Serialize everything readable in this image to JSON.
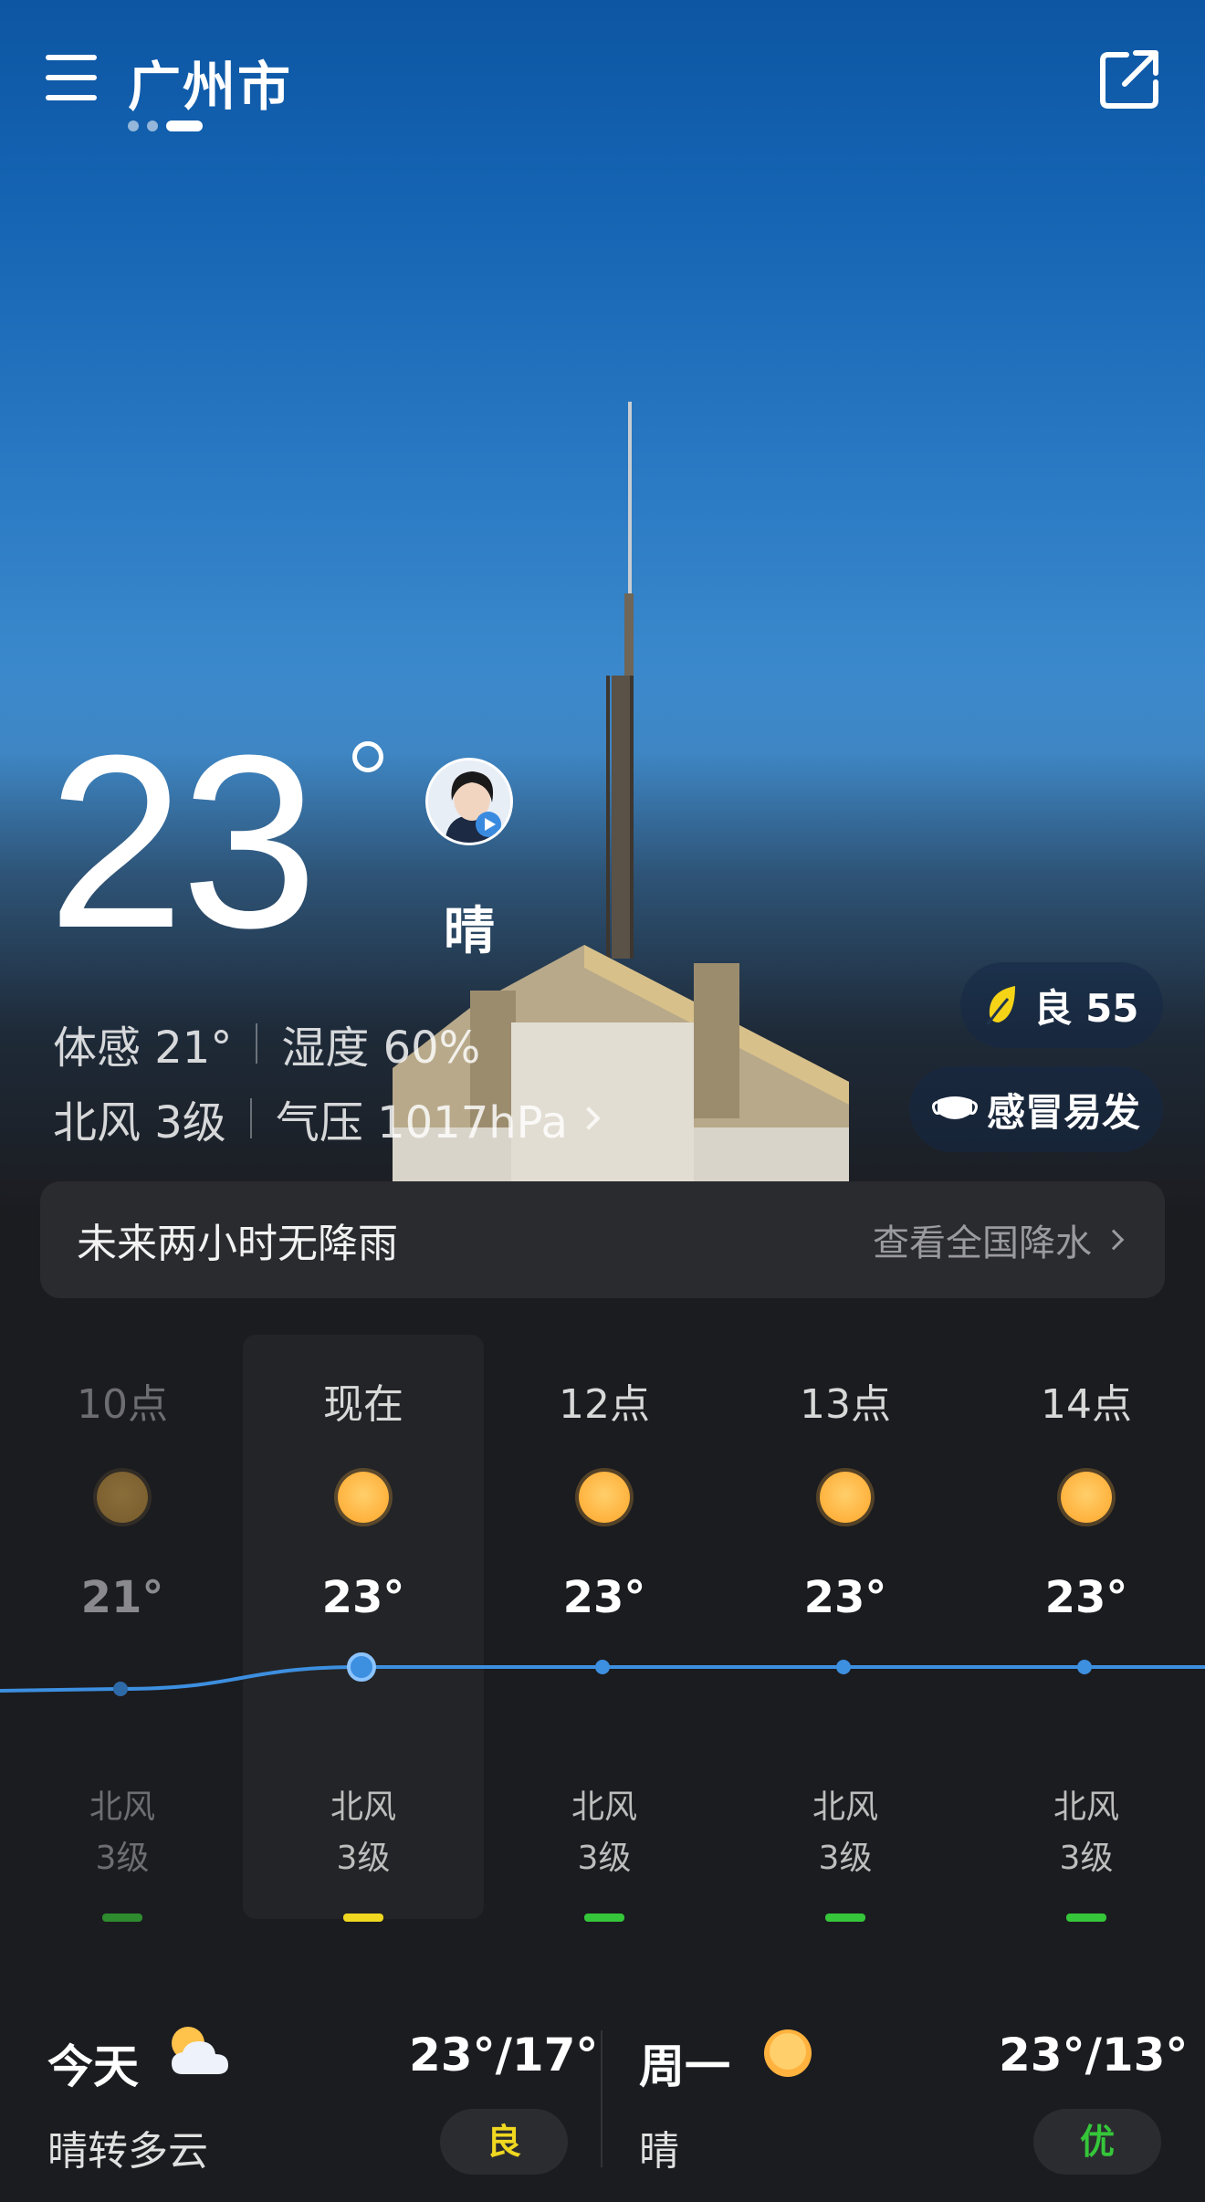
{
  "header": {
    "city": "广州市",
    "menu_icon": "menu-icon",
    "share_icon": "share-icon",
    "page_count": 3,
    "active_page": 3
  },
  "current": {
    "temperature": "23",
    "condition": "晴",
    "feels_like": "体感 21°",
    "humidity": "湿度 60%",
    "wind": "北风 3级",
    "pressure": "气压 1017hPa",
    "air_quality": "良 55",
    "health_tip": "感冒易发",
    "colors": {
      "leaf": "#f5d417",
      "sky_top": "#0d56a3"
    }
  },
  "rain": {
    "message": "未来两小时无降雨",
    "link": "查看全国降水"
  },
  "hourly": [
    {
      "time": "10点",
      "temp": "21°",
      "wind_dir": "北风",
      "wind_level": "3级",
      "aq_color": "#2e8b2e",
      "state": "past",
      "temp_value": 21
    },
    {
      "time": "现在",
      "temp": "23°",
      "wind_dir": "北风",
      "wind_level": "3级",
      "aq_color": "#f0d820",
      "state": "now",
      "temp_value": 23
    },
    {
      "time": "12点",
      "temp": "23°",
      "wind_dir": "北风",
      "wind_level": "3级",
      "aq_color": "#35c63a",
      "state": "future",
      "temp_value": 23
    },
    {
      "time": "13点",
      "temp": "23°",
      "wind_dir": "北风",
      "wind_level": "3级",
      "aq_color": "#35c63a",
      "state": "future",
      "temp_value": 23
    },
    {
      "time": "14点",
      "temp": "23°",
      "wind_dir": "北风",
      "wind_level": "3级",
      "aq_color": "#35c63a",
      "state": "future",
      "temp_value": 23
    }
  ],
  "daily": [
    {
      "name": "今天",
      "range": "23°/17°",
      "condition": "晴转多云",
      "aq": "良",
      "aq_color": "#f0d820",
      "icon": "partly-cloudy-icon"
    },
    {
      "name": "周一",
      "range": "23°/13°",
      "condition": "晴",
      "aq": "优",
      "aq_color": "#35c63a",
      "icon": "sun-icon"
    }
  ]
}
